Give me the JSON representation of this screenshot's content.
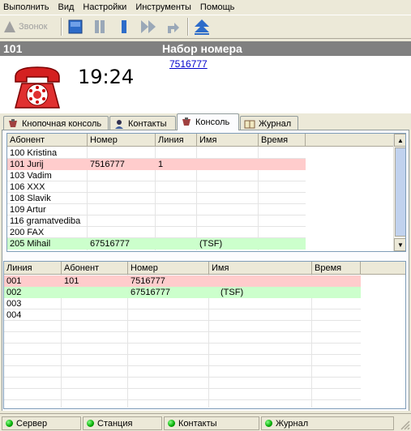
{
  "menu": [
    "Выполнить",
    "Вид",
    "Настройки",
    "Инструменты",
    "Помощь"
  ],
  "toolbar": {
    "call_label": "Звонок"
  },
  "call": {
    "extension": "101",
    "status_title": "Набор номера",
    "timer": "19:24",
    "dialed_number": "7516777"
  },
  "tabs": [
    {
      "label": "Кнопочная консоль",
      "icon": "keypad-icon"
    },
    {
      "label": "Контакты",
      "icon": "contacts-icon"
    },
    {
      "label": "Консоль",
      "icon": "console-icon"
    },
    {
      "label": "Журнал",
      "icon": "journal-icon"
    }
  ],
  "active_tab": "Консоль",
  "subscribers": {
    "columns": [
      "Абонент",
      "Номер",
      "Линия",
      "Имя",
      "Время"
    ],
    "rows": [
      {
        "subscriber": "100 Kristina",
        "number": "",
        "line": "",
        "name": "",
        "time": "",
        "state": "idle"
      },
      {
        "subscriber": "101 Jurij",
        "number": "7516777",
        "line": "1",
        "name": "",
        "time": "",
        "state": "dialing"
      },
      {
        "subscriber": "103 Vadim",
        "number": "",
        "line": "",
        "name": "",
        "time": "",
        "state": "idle"
      },
      {
        "subscriber": "106 XXX",
        "number": "",
        "line": "",
        "name": "",
        "time": "",
        "state": "idle"
      },
      {
        "subscriber": "108 Slavik",
        "number": "",
        "line": "",
        "name": "",
        "time": "",
        "state": "idle"
      },
      {
        "subscriber": "109 Artur",
        "number": "",
        "line": "",
        "name": "",
        "time": "",
        "state": "idle"
      },
      {
        "subscriber": "116 gramatvediba",
        "number": "",
        "line": "",
        "name": "",
        "time": "",
        "state": "idle"
      },
      {
        "subscriber": "200 FAX",
        "number": "",
        "line": "",
        "name": "",
        "time": "",
        "state": "idle"
      },
      {
        "subscriber": "205 Mihail",
        "number": "67516777",
        "line": "",
        "name": "(TSF)",
        "time": "",
        "state": "talking"
      }
    ]
  },
  "lines": {
    "columns": [
      "Линия",
      "Абонент",
      "Номер",
      "Имя",
      "Время"
    ],
    "rows": [
      {
        "line": "001",
        "subscriber": "101",
        "number": "7516777",
        "name": "",
        "time": "",
        "state": "dialing"
      },
      {
        "line": "002",
        "subscriber": "",
        "number": "67516777",
        "name": "(TSF)",
        "time": "",
        "state": "talking"
      },
      {
        "line": "003",
        "subscriber": "",
        "number": "",
        "name": "",
        "time": "",
        "state": "idle"
      },
      {
        "line": "004",
        "subscriber": "",
        "number": "",
        "name": "",
        "time": "",
        "state": "idle"
      }
    ]
  },
  "statusbar": [
    "Сервер",
    "Станция",
    "Контакты",
    "Журнал"
  ],
  "colors": {
    "dialing": "#ffcccc",
    "talking": "#ccffcc",
    "header_bar": "#808080",
    "link": "#0000cc"
  }
}
